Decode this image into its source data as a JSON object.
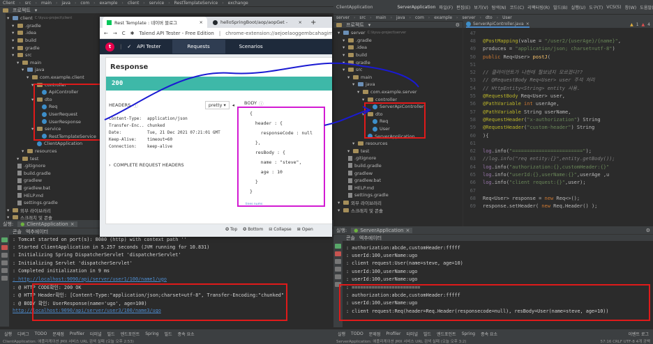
{
  "left": {
    "menu": [
      "Client",
      "src",
      "main",
      "java",
      "com",
      "example",
      "client",
      "service",
      "RestTemplateService",
      "exchange"
    ],
    "project_label": "프로젝트",
    "tree": [
      {
        "label": "client",
        "note": "C:\\kyuu-project\\client",
        "indent": 0,
        "icon": "folder-blue"
      },
      {
        "label": ".gradle",
        "indent": 1,
        "icon": "folder"
      },
      {
        "label": ".idea",
        "indent": 1,
        "icon": "folder"
      },
      {
        "label": "build",
        "indent": 1,
        "icon": "folder"
      },
      {
        "label": "gradle",
        "indent": 1,
        "icon": "folder"
      },
      {
        "label": "src",
        "indent": 1,
        "icon": "folder"
      },
      {
        "label": "main",
        "indent": 2,
        "icon": "folder"
      },
      {
        "label": "java",
        "indent": 3,
        "icon": "folder-blue"
      },
      {
        "label": "com.example.client",
        "indent": 4,
        "icon": "folder"
      },
      {
        "label": "controller",
        "indent": 5,
        "icon": "folder"
      },
      {
        "label": "ApiController",
        "indent": 6,
        "icon": "class"
      },
      {
        "label": "dto",
        "indent": 5,
        "icon": "folder"
      },
      {
        "label": "Req",
        "indent": 6,
        "icon": "class"
      },
      {
        "label": "UserRequest",
        "indent": 6,
        "icon": "class"
      },
      {
        "label": "UserResponse",
        "indent": 6,
        "icon": "class"
      },
      {
        "label": "service",
        "indent": 5,
        "icon": "folder"
      },
      {
        "label": "RestTemplateService",
        "indent": 6,
        "icon": "class"
      },
      {
        "label": "ClientApplication",
        "indent": 5,
        "icon": "class"
      },
      {
        "label": "resources",
        "indent": 3,
        "icon": "folder"
      },
      {
        "label": "test",
        "indent": 2,
        "icon": "folder"
      },
      {
        "label": ".gitignore",
        "indent": 1,
        "icon": "file"
      },
      {
        "label": "build.gradle",
        "indent": 1,
        "icon": "file"
      },
      {
        "label": "gradlew",
        "indent": 1,
        "icon": "file"
      },
      {
        "label": "gradlew.bat",
        "indent": 1,
        "icon": "file"
      },
      {
        "label": "HELP.md",
        "indent": 1,
        "icon": "file"
      },
      {
        "label": "settings.gradle",
        "indent": 1,
        "icon": "file"
      },
      {
        "label": "외부 라이브러리",
        "indent": 0,
        "icon": "folder"
      },
      {
        "label": "스크래치 및 콘솔",
        "indent": 0,
        "icon": "folder"
      }
    ],
    "run_label": "실행:",
    "run_tab": "ClientApplication",
    "console_tabs": [
      "콘솔",
      "엑추에이터"
    ],
    "console": [
      {
        "text": ": Tomcat started on port(s): 8080 (http) with context path ''",
        "link": false
      },
      {
        "text": ": Started ClientApplication in 5.257 seconds (JVM running for 10.831)",
        "link": false
      },
      {
        "text": ": Initializing Spring DispatcherServlet 'dispatcherServlet'",
        "link": false
      },
      {
        "text": ": Initializing Servlet 'dispatcherServlet'",
        "link": false
      },
      {
        "text": ": Completed initialization in 9 ms",
        "link": false
      },
      {
        "text": ": http://localhost:9090/api/server/user1/100/name1/ugo",
        "link": true
      },
      {
        "text": ": @ HTTP CODE확인: 200 OK",
        "link": false
      },
      {
        "text": ": @ HTTP Header확인: [Content-Type:\"application/json;charset=utf-8\", Transfer-Encoding:\"chunked\"",
        "link": false
      },
      {
        "text": ": @ BODY 확인: UserResponse(name='ugo', age=100)",
        "link": false
      },
      {
        "text": "  http://localhost:9090/api/server/user3/100/name3/ugo",
        "link": true
      }
    ],
    "bottom_tools": [
      "실행",
      "디버그",
      "TODO",
      "문제점",
      "Profiler",
      "터미널",
      "빌드",
      "엔드포인트",
      "Spring",
      "빌드",
      "종속 요소"
    ],
    "status": "ClientApplication: 애플리케이션 JMX 서비스 URL 검색 실패 (오늘 오후 2:53)"
  },
  "browser": {
    "tabs": [
      "Rest Template : 네이버 블로그",
      "helloSpringBoot/aop/aopGet -"
    ],
    "new_tab": "+",
    "address_title": "Talend API Tester - Free Edition",
    "address_url": "chrome-extension://aejoelaoggembcahagimd...",
    "app_letter": "t",
    "app_name": "API Tester",
    "app_tabs": [
      "Requests",
      "Scenarios"
    ],
    "response_title": "Response",
    "status_code": "200",
    "headers_label": "HEADERS",
    "pretty_label": "pretty",
    "body_label": "BODY",
    "headers": [
      {
        "k": "Content-Type:",
        "v": "application/json"
      },
      {
        "k": "Transfer-Enc..",
        "v": "chunked"
      },
      {
        "k": "Date:",
        "v": "Tue, 21 Dec 2021 07:21:01 GMT"
      },
      {
        "k": "Keep-Alive:",
        "v": "timeout=60"
      },
      {
        "k": "Connection:",
        "v": "keep-alive"
      }
    ],
    "complete_headers": "COMPLETE REQUEST HEADERS",
    "body_lines": [
      "{",
      "  header : {",
      "    responseCode : null",
      "  },",
      "  resBody : {",
      "    name : \"steve\",",
      "    age : 10",
      "  }",
      "}"
    ],
    "lines_nums": "lines nums",
    "footer": [
      "Top",
      "Bottom",
      "Collapse",
      "Open"
    ]
  },
  "right": {
    "title_app": "ClientApplication",
    "menu_items": [
      "파일(F)",
      "편집(E)",
      "보기(V)",
      "탐색(N)",
      "코드(C)",
      "리팩터링(R)",
      "빌드(B)",
      "실행(U)",
      "도구(T)",
      "VCS(S)",
      "창(W)",
      "도움말(H)",
      "server"
    ],
    "breadcrumb": [
      "server",
      "src",
      "main",
      "java",
      "com",
      "example",
      "server",
      "dto",
      "User"
    ],
    "run_config": "ServerApplication",
    "project_label": "프로젝트",
    "editor_tab": "ServerApiController.java",
    "warn_count": "1",
    "err_count": "4",
    "tree": [
      {
        "label": "server",
        "note": "C:\\kyuu-project\\server",
        "indent": 0,
        "icon": "folder-blue"
      },
      {
        "label": ".gradle",
        "indent": 1,
        "icon": "folder"
      },
      {
        "label": ".idea",
        "indent": 1,
        "icon": "folder"
      },
      {
        "label": "build",
        "indent": 1,
        "icon": "folder"
      },
      {
        "label": "gradle",
        "indent": 1,
        "icon": "folder"
      },
      {
        "label": "src",
        "indent": 1,
        "icon": "folder"
      },
      {
        "label": "main",
        "indent": 2,
        "icon": "folder"
      },
      {
        "label": "java",
        "indent": 3,
        "icon": "folder-blue"
      },
      {
        "label": "com.example.server",
        "indent": 4,
        "icon": "folder"
      },
      {
        "label": "controller",
        "indent": 5,
        "icon": "folder"
      },
      {
        "label": "ServerApiController",
        "indent": 6,
        "icon": "class"
      },
      {
        "label": "dto",
        "indent": 5,
        "icon": "folder"
      },
      {
        "label": "Req",
        "indent": 6,
        "icon": "class"
      },
      {
        "label": "User",
        "indent": 6,
        "icon": "class"
      },
      {
        "label": "ServerApplication",
        "indent": 5,
        "icon": "class"
      },
      {
        "label": "resources",
        "indent": 3,
        "icon": "folder"
      },
      {
        "label": "test",
        "indent": 2,
        "icon": "folder"
      },
      {
        "label": ".gitignore",
        "indent": 1,
        "icon": "file"
      },
      {
        "label": "build.gradle",
        "indent": 1,
        "icon": "file"
      },
      {
        "label": "gradlew",
        "indent": 1,
        "icon": "file"
      },
      {
        "label": "gradlew.bat",
        "indent": 1,
        "icon": "file"
      },
      {
        "label": "HELP.md",
        "indent": 1,
        "icon": "file"
      },
      {
        "label": "settings.gradle",
        "indent": 1,
        "icon": "file"
      },
      {
        "label": "외부 라이브러리",
        "indent": 0,
        "icon": "folder"
      },
      {
        "label": "스크래치 및 콘솔",
        "indent": 0,
        "icon": "folder"
      }
    ],
    "code": [
      {
        "n": "47",
        "html": ""
      },
      {
        "n": "48",
        "html": "<span class='ann'>@PostMapping</span>(value = <span class='str'>\"/user2/{userAge}/{name}\"</span>,"
      },
      {
        "n": "49",
        "html": "        produces = <span class='str'>\"application/json; charset=utf-8\"</span>)"
      },
      {
        "n": "50",
        "html": "<span class='kw'>public</span> Req&lt;User&gt; <span class='fn'>postJ</span>("
      },
      {
        "n": "51",
        "html": ""
      },
      {
        "n": "52",
        "html": "    <span class='cmt'>// 클라이언트가 나한테 뭘보냈지 모르겠다??</span>"
      },
      {
        "n": "53",
        "html": "    <span class='cmt'>// @RequestBody Req&lt;User&gt; user 주석 처리</span>"
      },
      {
        "n": "54",
        "html": "    <span class='cmt'>// HttpEntity&lt;String&gt; entity 사용.</span>"
      },
      {
        "n": "55",
        "html": "    <span class='ann'>@RequestBody</span> Req&lt;User&gt; user,"
      },
      {
        "n": "56",
        "html": "    <span class='ann'>@PathVariable</span> <span class='kw'>int</span> userAge,"
      },
      {
        "n": "57",
        "html": "    <span class='ann'>@PathVariable</span> String userName,"
      },
      {
        "n": "58",
        "html": "    <span class='ann'>@RequestHeader</span>(<span class='str'>\"x-authorization\"</span>) String"
      },
      {
        "n": "59",
        "html": "    <span class='ann'>@RequestHeader</span>(<span class='str'>\"custom-header\"</span>) String"
      },
      {
        "n": "60",
        "html": "){"
      },
      {
        "n": "61",
        "html": ""
      },
      {
        "n": "62",
        "html": "    <span class='pur'>log</span>.info(<span class='str'>\"========================\"</span>);"
      },
      {
        "n": "63",
        "html": "    <span class='cmt'>//log.info(\"req entity:{}\",entity.getBody());</span>"
      },
      {
        "n": "64",
        "html": "    <span class='pur'>log</span>.info(<span class='str'>\"authorization:{},customHeader:{}\"</span>"
      },
      {
        "n": "65",
        "html": "    <span class='pur'>log</span>.info(<span class='str'>\"userId:{},userName:{}\"</span>,userAge ,u"
      },
      {
        "n": "66",
        "html": "    <span class='pur'>log</span>.info(<span class='str'>\"client request:{}\"</span>,user);"
      },
      {
        "n": "67",
        "html": ""
      },
      {
        "n": "68",
        "html": "    Req&lt;User&gt; response = <span class='kw'>new</span> Req&lt;&gt;();"
      },
      {
        "n": "69",
        "html": "    response.setHeader( <span class='kw'>new</span> Req.Header() );"
      }
    ],
    "run_label": "실행:",
    "run_tab": "ServerApplication",
    "console_tabs": [
      "콘솔",
      "엑추에이터"
    ],
    "console": [
      ": authorization:abcde,customHeader:fffff",
      ": userId:100,userName:ugo",
      ": client request:User(name=steve, age=10)",
      ": userId:100,userName:ugo",
      ": userId:100,userName:ugo",
      ": ========================",
      ": authorization:abcde,customHeader:fffff",
      ": userId:100,userName:ugo",
      ": client request:Req(header=Req.Header(responsecode=null), resBody=User(name=steve, age=10))"
    ],
    "bottom_tools": [
      "실행",
      "TODO",
      "문제점",
      "Profiler",
      "터미널",
      "빌드",
      "엔드포인트",
      "Spring",
      "종속 요소"
    ],
    "event_log": "이벤트 로그",
    "status": "ServerApplication: 애플리케이션 JMX 서비스 URL 검색 실패 (오늘 오후 3:2)",
    "status_right": "57:16  CRLF  UTF-8  4개 공백"
  },
  "colors": {
    "accent_red": "#e01a1a",
    "accent_pink": "#d21ad2",
    "arrow_blue": "#1a1ad2",
    "status_green": "#3eb8a8",
    "talend_red": "#e6004c"
  }
}
